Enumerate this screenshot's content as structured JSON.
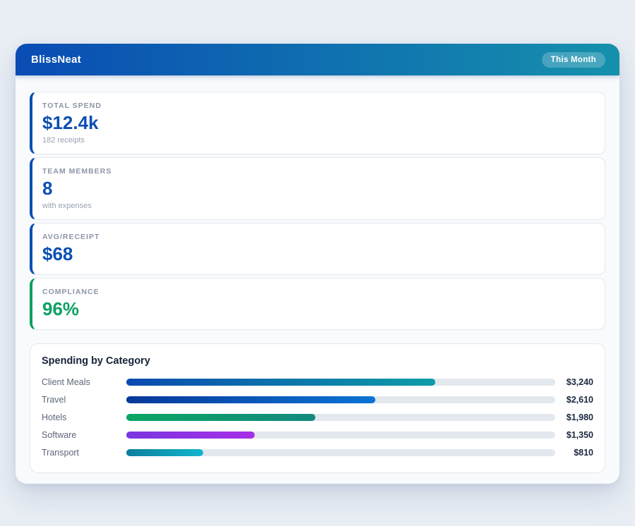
{
  "app": {
    "title": "BlissNeat",
    "period_badge": "This Month"
  },
  "colors": {
    "header_gradient_start": "#0a4cb4",
    "header_gradient_end": "#1591ac",
    "accent_blue": "#0b4fb3",
    "accent_green": "#0d9f62",
    "bar_track": "#e3e8ef",
    "page_background": "#e9eef4"
  },
  "stats": [
    {
      "label": "TOTAL SPEND",
      "value": "$12.4k",
      "sub": "182 receipts",
      "accent": "#0b4fb3",
      "value_color": "#0b4fb3"
    },
    {
      "label": "TEAM MEMBERS",
      "value": "8",
      "sub": "with expenses",
      "accent": "#0b4fb3",
      "value_color": "#0b4fb3"
    },
    {
      "label": "AVG/RECEIPT",
      "value": "$68",
      "sub": "",
      "accent": "#0b4fb3",
      "value_color": "#0b4fb3"
    },
    {
      "label": "COMPLIANCE",
      "value": "96%",
      "sub": "",
      "accent": "#0d9f62",
      "value_color": "#0d9f62"
    }
  ],
  "chart_data": {
    "type": "bar",
    "orientation": "horizontal",
    "title": "Spending by Category",
    "categories": [
      "Client Meals",
      "Travel",
      "Hotels",
      "Software",
      "Transport"
    ],
    "values": [
      3240,
      2610,
      1980,
      1350,
      810
    ],
    "value_labels": [
      "$3,240",
      "$2,610",
      "$1,980",
      "$1,350",
      "$810"
    ],
    "axis_max": 4500,
    "bar_gradients": [
      [
        "#0b4ab0",
        "#0d9da6"
      ],
      [
        "#08389a",
        "#0b74d4"
      ],
      [
        "#0ba563",
        "#13897f"
      ],
      [
        "#7a36df",
        "#a62ee6"
      ],
      [
        "#0d7e9c",
        "#12b6cd"
      ]
    ]
  }
}
